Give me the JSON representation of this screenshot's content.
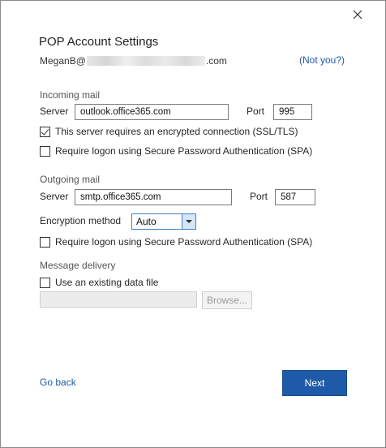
{
  "dialog": {
    "title": "POP Account Settings",
    "email_prefix": "MeganB@",
    "email_suffix": ".com",
    "not_you": "(Not you?)"
  },
  "incoming": {
    "heading": "Incoming mail",
    "server_label": "Server",
    "server_value": "outlook.office365.com",
    "port_label": "Port",
    "port_value": "995",
    "ssl_label": "This server requires an encrypted connection (SSL/TLS)",
    "ssl_checked": true,
    "spa_label": "Require logon using Secure Password Authentication (SPA)",
    "spa_checked": false
  },
  "outgoing": {
    "heading": "Outgoing mail",
    "server_label": "Server",
    "server_value": "smtp.office365.com",
    "port_label": "Port",
    "port_value": "587",
    "encryption_label": "Encryption method",
    "encryption_value": "Auto",
    "spa_label": "Require logon using Secure Password Authentication (SPA)",
    "spa_checked": false
  },
  "delivery": {
    "heading": "Message delivery",
    "existing_label": "Use an existing data file",
    "existing_checked": false,
    "browse_label": "Browse..."
  },
  "footer": {
    "go_back": "Go back",
    "next": "Next"
  },
  "colors": {
    "accent": "#1e5aa8",
    "link": "#1e5aa8",
    "select_arrow_bg": "#d4e6f7"
  },
  "icons": {
    "close": "close-icon",
    "checkmark": "checkmark-icon",
    "dropdown": "chevron-down-icon"
  }
}
